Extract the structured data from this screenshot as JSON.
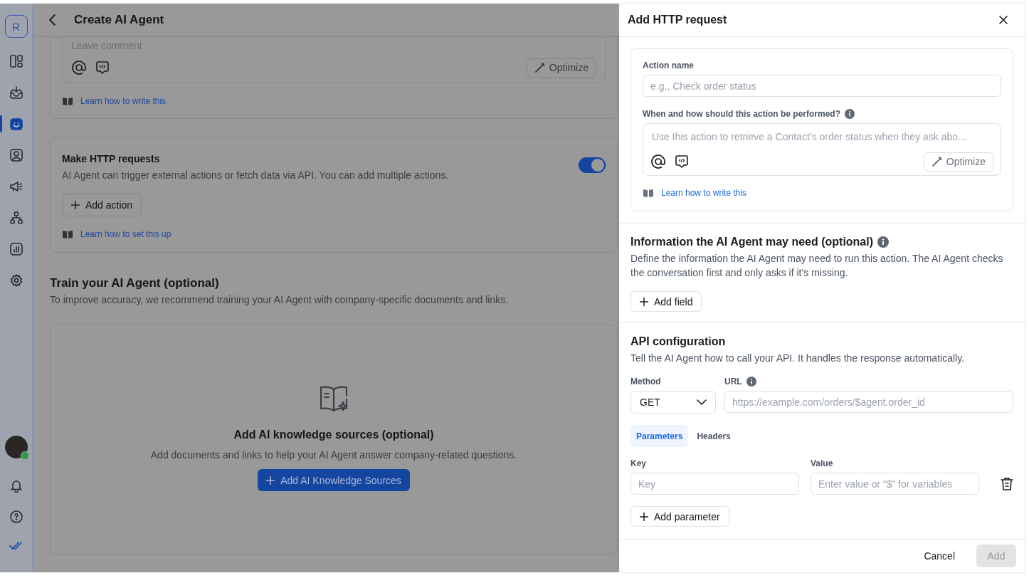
{
  "sidebar": {
    "workspace_initial": "R",
    "items": [
      {
        "selected": false
      },
      {
        "selected": false
      },
      {
        "selected": true
      },
      {
        "selected": false
      },
      {
        "selected": false
      },
      {
        "selected": false
      },
      {
        "selected": false
      },
      {
        "selected": false
      }
    ],
    "user": {
      "online": true
    }
  },
  "header": {
    "title": "Create AI Agent"
  },
  "instructions_card": {
    "comment_placeholder": "Leave comment",
    "optimize_label": "Optimize",
    "link": "Learn how to write this"
  },
  "http_card": {
    "title": "Make HTTP requests",
    "description": "AI Agent can trigger external actions or fetch data via API. You can add multiple actions.",
    "enabled": true,
    "add_button": "Add action",
    "link": "Learn how to set this up"
  },
  "training": {
    "title": "Train your AI Agent (optional)",
    "description": "To improve accuracy, we recommend training your AI Agent with company-specific documents and links."
  },
  "knowledge": {
    "title": "Add AI knowledge sources (optional)",
    "description": "Add documents and links to help your AI Agent answer company-related questions.",
    "button": "Add AI Knowledge Sources"
  },
  "drawer": {
    "title": "Add HTTP request",
    "action_card": {
      "name_label": "Action name",
      "name_placeholder": "e.g., Check order status",
      "when_label": "When and how should this action be performed?",
      "when_placeholder": "Use this action to retrieve a Contact’s order status when they ask abo...",
      "optimize_label": "Optimize",
      "link": "Learn how to write this"
    },
    "info_section": {
      "title": "Information the AI Agent may need (optional)",
      "description": "Define the information the AI Agent may need to run this action. The AI Agent checks the conversation first and only asks if it’s missing.",
      "add_button": "Add field"
    },
    "api": {
      "title": "API configuration",
      "description": "Tell the AI Agent how to call your API. It handles the response automatically.",
      "method_label": "Method",
      "method_value": "GET",
      "url_label": "URL",
      "url_placeholder": "https://example.com/orders/$agent.order_id",
      "tabs": [
        {
          "label": "Parameters",
          "selected": true
        },
        {
          "label": "Headers",
          "selected": false
        }
      ],
      "key_label": "Key",
      "value_label": "Value",
      "key_placeholder": "Key",
      "value_placeholder": "Enter value or “$” for variables",
      "add_parameter": "Add parameter"
    },
    "footer": {
      "cancel": "Cancel",
      "add": "Add",
      "add_disabled": true
    }
  }
}
